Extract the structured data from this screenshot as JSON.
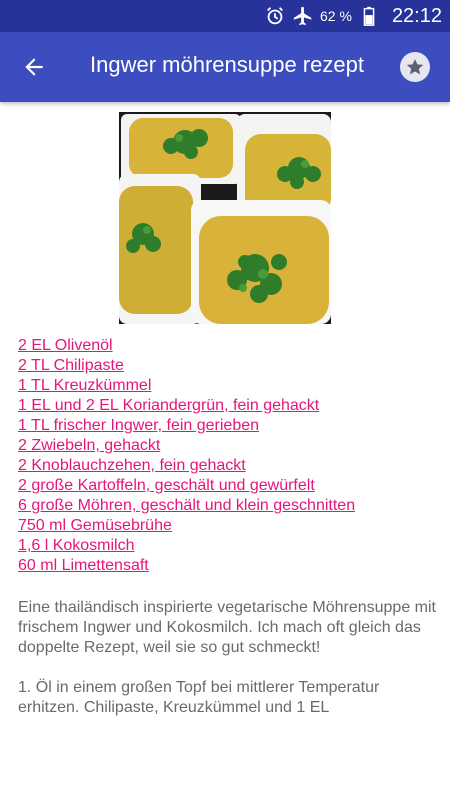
{
  "status_bar": {
    "icons": [
      "alarm-icon",
      "airplane-icon",
      "battery-icon"
    ],
    "battery": "62 %",
    "time": "22:12"
  },
  "toolbar": {
    "title": "Ingwer möhrensuppe rezept",
    "back_icon": "arrow-left-icon",
    "favorite_icon": "star-icon"
  },
  "ingredients": [
    "2 EL Olivenöl",
    "2 TL Chilipaste",
    "1 TL Kreuzkümmel",
    "1 EL und 2 EL Koriandergrün, fein gehackt",
    "1 TL frischer Ingwer, fein gerieben",
    "2 Zwiebeln, gehackt",
    "2 Knoblauchzehen, fein gehackt",
    "2 große Kartoffeln, geschält und gewürfelt",
    "6 große Möhren, geschält und klein geschnitten",
    "750 ml Gemüsebrühe",
    "1,6 l Kokosmilch",
    "60 ml Limettensaft"
  ],
  "description": {
    "intro": "Eine thailändisch inspirierte vegetarische Möhrensuppe mit frischem Ingwer und Kokosmilch. Ich mach oft gleich das doppelte Rezept, weil sie so gut schmeckt!",
    "step1": "1. Öl in einem großen Topf bei mittlerer Temperatur erhitzen. Chilipaste, Kreuzkümmel und 1 EL"
  },
  "colors": {
    "status_bar": "#27339a",
    "toolbar": "#3c4dc0",
    "ingredient_link": "#e6157b",
    "body_text": "#6a6a6a"
  }
}
